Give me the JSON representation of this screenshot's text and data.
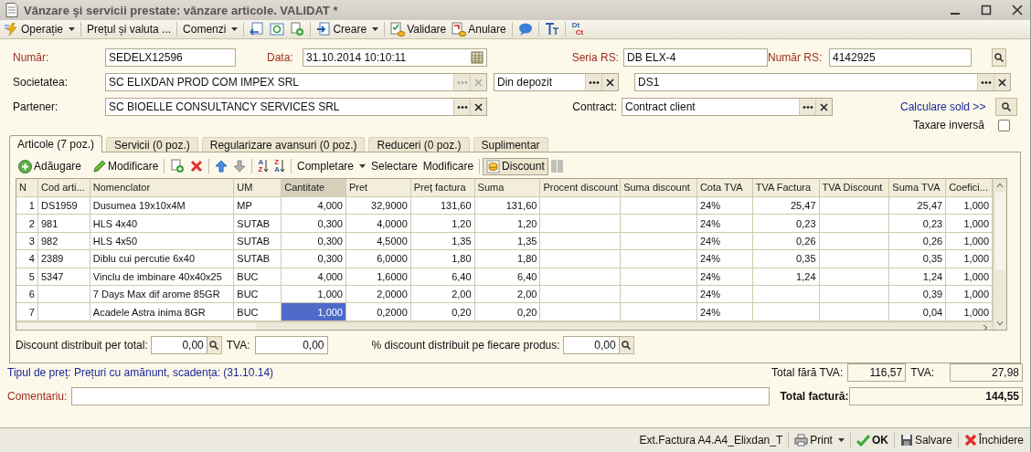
{
  "window": {
    "title": "Vânzare şi servicii prestate: vânzare articole. VALIDAT *"
  },
  "toolbar": {
    "operation": {
      "label": "Operație",
      "dropdown": true
    },
    "price": {
      "label": "Prețul și valuta ..."
    },
    "orders": {
      "label": "Comenzi",
      "dropdown": true
    },
    "create": {
      "label": "Creare",
      "dropdown": true
    },
    "validate": {
      "label": "Validare"
    },
    "cancel": {
      "label": "Anulare"
    },
    "dt_ct": [
      "Dt",
      "Ct"
    ]
  },
  "form": {
    "numar": {
      "label": "Număr:",
      "value": "SEDELX12596",
      "required": true
    },
    "data": {
      "label": "Data:",
      "value": "31.10.2014 10:10:11",
      "required": true
    },
    "seria_rs": {
      "label": "Seria RS:",
      "value": "DB ELX-4",
      "required": true
    },
    "numar_rs": {
      "label": "Număr RS:",
      "value": "4142925",
      "required": true
    },
    "societatea": {
      "label": "Societatea:",
      "value": "SC ELIXDAN PROD COM IMPEX SRL",
      "required": false,
      "disabled": true
    },
    "depozit": {
      "value": "Din depozit",
      "disabled": false
    },
    "gestiune": {
      "value": "DS1",
      "disabled": false
    },
    "partener": {
      "label": "Partener:",
      "value": "SC BIOELLE CONSULTANCY SERVICES SRL",
      "required": false,
      "disabled": false
    },
    "contract": {
      "label": "Contract:",
      "value": "Contract client",
      "required": false,
      "disabled": false
    },
    "calculare_sold": "Calculare sold >>",
    "taxare_inversa": {
      "label": "Taxare inversă",
      "checked": false
    }
  },
  "tabs": [
    {
      "label": "Articole (7 poz.)",
      "selected": true
    },
    {
      "label": "Servicii (0 poz.)",
      "selected": false
    },
    {
      "label": "Regularizare avansuri (0 poz.)",
      "selected": false
    },
    {
      "label": "Reduceri (0 poz.)",
      "selected": false
    },
    {
      "label": "Suplimentar",
      "selected": false
    }
  ],
  "grid_toolbar": {
    "add": "Adăugare",
    "edit": "Modificare",
    "sort_asc": [
      "A",
      "Z"
    ],
    "sort_desc": [
      "Z",
      "A"
    ],
    "fill": {
      "label": "Completare",
      "dropdown": true
    },
    "select": "Selectare",
    "modify": "Modificare",
    "discount": {
      "label": "Discount",
      "pressed": true
    }
  },
  "table": {
    "columns": [
      {
        "label": "N",
        "kind": "number",
        "selected": false
      },
      {
        "label": "Cod arti...",
        "kind": "text",
        "selected": false
      },
      {
        "label": "Nomenclator",
        "kind": "text",
        "selected": false
      },
      {
        "label": "UM",
        "kind": "text",
        "selected": false
      },
      {
        "label": "Cantitate",
        "kind": "number",
        "selected": true
      },
      {
        "label": "Pret",
        "kind": "number",
        "selected": false
      },
      {
        "label": "Preț factura",
        "kind": "number",
        "selected": false
      },
      {
        "label": "Suma",
        "kind": "number",
        "selected": false
      },
      {
        "label": "Procent discount",
        "kind": "number",
        "selected": false
      },
      {
        "label": "Suma discount",
        "kind": "number",
        "selected": false
      },
      {
        "label": "Cota TVA",
        "kind": "text",
        "selected": false
      },
      {
        "label": "TVA Factura",
        "kind": "number",
        "selected": false
      },
      {
        "label": "TVA Discount",
        "kind": "number",
        "selected": false
      },
      {
        "label": "Suma TVA",
        "kind": "number",
        "selected": false
      },
      {
        "label": "Coefici...",
        "kind": "number",
        "selected": false
      }
    ],
    "rows": [
      {
        "selected": false,
        "cells": [
          "1",
          "DS1959",
          "Dusumea 19x10x4M",
          "MP",
          "4,000",
          "32,9000",
          "131,60",
          "131,60",
          null,
          null,
          "24%",
          "25,47",
          null,
          "25,47",
          "1,000"
        ]
      },
      {
        "selected": false,
        "cells": [
          "2",
          "981",
          "HLS 4x40",
          "SUTAB",
          "0,300",
          "4,0000",
          "1,20",
          "1,20",
          null,
          null,
          "24%",
          "0,23",
          null,
          "0,23",
          "1,000"
        ]
      },
      {
        "selected": false,
        "cells": [
          "3",
          "982",
          "HLS 4x50",
          "SUTAB",
          "0,300",
          "4,5000",
          "1,35",
          "1,35",
          null,
          null,
          "24%",
          "0,26",
          null,
          "0,26",
          "1,000"
        ]
      },
      {
        "selected": false,
        "cells": [
          "4",
          "2389",
          "Diblu cui percutie 6x40",
          "SUTAB",
          "0,300",
          "6,0000",
          "1,80",
          "1,80",
          null,
          null,
          "24%",
          "0,35",
          null,
          "0,35",
          "1,000"
        ]
      },
      {
        "selected": false,
        "cells": [
          "5",
          "5347",
          "Vinclu de imbinare 40x40x25",
          "BUC",
          "4,000",
          "1,6000",
          "6,40",
          "6,40",
          null,
          null,
          "24%",
          "1,24",
          null,
          "1,24",
          "1,000"
        ]
      },
      {
        "selected": false,
        "cells": [
          "6",
          null,
          "7 Days Max dif arome 85GR",
          "BUC",
          "1,000",
          "2,0000",
          "2,00",
          "2,00",
          null,
          null,
          "24%",
          null,
          null,
          "0,39",
          "1,000"
        ]
      },
      {
        "selected": true,
        "cells": [
          "7",
          null,
          "Acadele Astra inima 8GR",
          "BUC",
          "1,000",
          "0,2000",
          "0,20",
          "0,20",
          null,
          null,
          "24%",
          null,
          null,
          "0,04",
          "1,000"
        ]
      }
    ]
  },
  "discount": {
    "per_total": {
      "label": "Discount distribuit per total:",
      "value": "0,00"
    },
    "tva": {
      "label": "TVA:",
      "value": "0,00"
    },
    "per_product": {
      "label": "% discount distribuit pe fiecare produs:",
      "value": "0,00"
    }
  },
  "price_type": "Tipul de preț: Prețuri cu amănunt, scadența:  (31.10.14)",
  "totals": {
    "without_vat": {
      "label": "Total fără TVA:",
      "value": "116,57"
    },
    "vat": {
      "label": "TVA:",
      "value": "27,98"
    },
    "total": {
      "label": "Total factură:",
      "value": "144,55"
    }
  },
  "comment": {
    "label": "Comentariu:",
    "required": true
  },
  "status_bar": {
    "report": "Ext.Factura A4.A4_Elixdan_T",
    "print": {
      "label": "Print",
      "dropdown": true
    },
    "ok": "OK",
    "save": "Salvare",
    "close": "Închidere"
  }
}
